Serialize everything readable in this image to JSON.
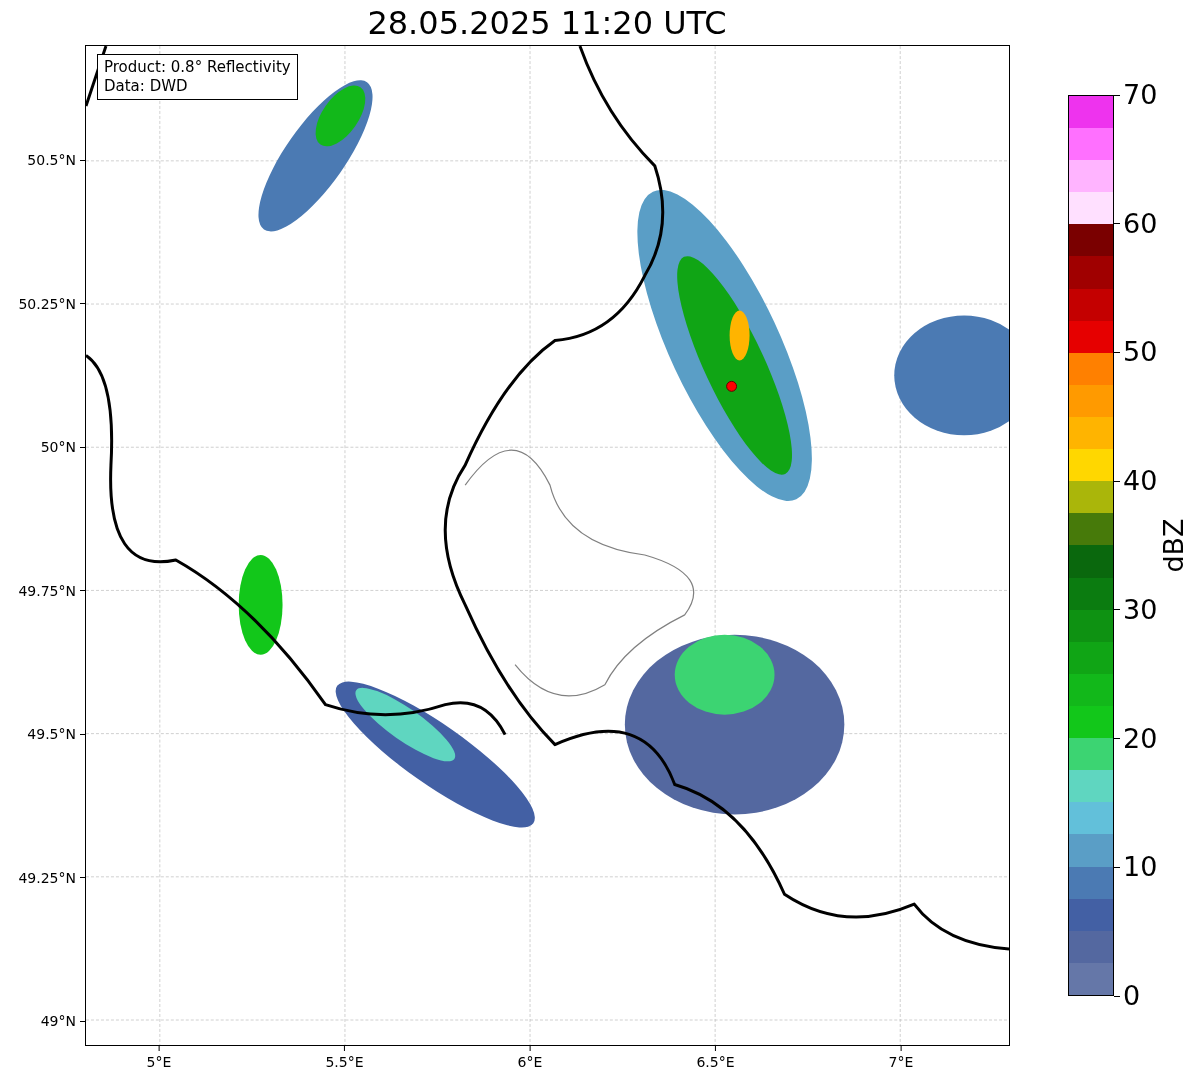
{
  "title": "28.05.2025 11:20 UTC",
  "info_box": [
    "Product: 0.8° Reflectivity",
    "Data: DWD"
  ],
  "map": {
    "xticks": [
      "5°E",
      "5.5°E",
      "6°E",
      "6.5°E",
      "7°E"
    ],
    "yticks": [
      "50.5°N",
      "50.25°N",
      "50°N",
      "49.75°N",
      "49.5°N",
      "49.25°N",
      "49°N"
    ]
  },
  "colorbar": {
    "label": "dBZ",
    "ticks": [
      "70",
      "60",
      "50",
      "40",
      "30",
      "20",
      "10",
      "0"
    ],
    "segments": [
      {
        "color": "#6577a8"
      },
      {
        "color": "#5468a0"
      },
      {
        "color": "#4360a4"
      },
      {
        "color": "#4b7ab3"
      },
      {
        "color": "#5a9ec6"
      },
      {
        "color": "#62c0da"
      },
      {
        "color": "#5fd6c0"
      },
      {
        "color": "#3cd472"
      },
      {
        "color": "#12c71a"
      },
      {
        "color": "#12b81a"
      },
      {
        "color": "#10a515"
      },
      {
        "color": "#0e9212"
      },
      {
        "color": "#0b7c10"
      },
      {
        "color": "#0a680d"
      },
      {
        "color": "#477a0a"
      },
      {
        "color": "#aab60a"
      },
      {
        "color": "#ffd700"
      },
      {
        "color": "#ffb400"
      },
      {
        "color": "#ff9a00"
      },
      {
        "color": "#ff8000"
      },
      {
        "color": "#e60000"
      },
      {
        "color": "#c40000"
      },
      {
        "color": "#a00000"
      },
      {
        "color": "#7a0000"
      },
      {
        "color": "#ffe0ff"
      },
      {
        "color": "#ffb4ff"
      },
      {
        "color": "#ff70ff"
      },
      {
        "color": "#ee33ee"
      }
    ]
  }
}
